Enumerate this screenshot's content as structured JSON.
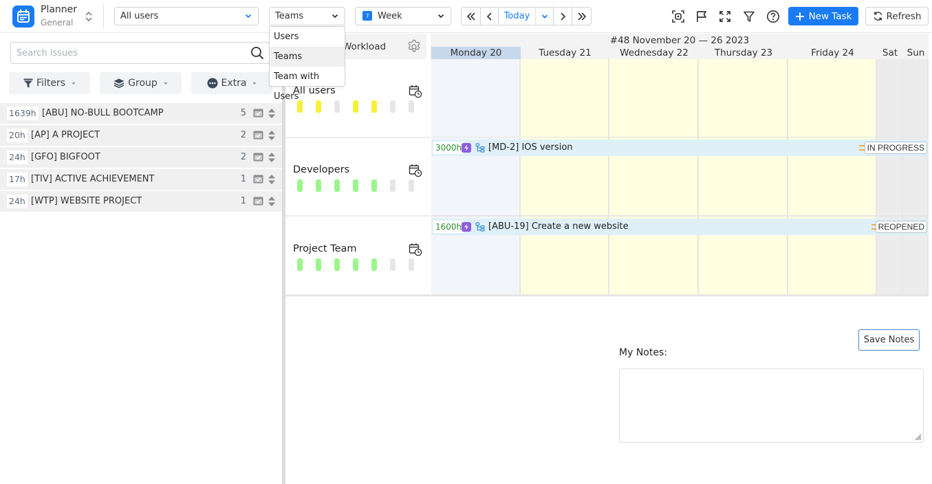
{
  "app": {
    "title": "Planner",
    "subtitle": "General"
  },
  "toolbar": {
    "user_select": "All users",
    "view_select": "Teams",
    "period_select": "Week",
    "period_icon_text": "7",
    "nav": {
      "today_label": "Today"
    },
    "new_task_label": "New Task",
    "refresh_label": "Refresh"
  },
  "view_dropdown": {
    "options": [
      "Users",
      "Teams",
      "Team with Users"
    ],
    "highlighted": "Teams"
  },
  "sidebar": {
    "search_placeholder": "Search issues",
    "buttons": {
      "filters": "Filters",
      "group": "Group",
      "extra": "Extra"
    },
    "projects": [
      {
        "hours": "1639h",
        "name": "[ABU] NO-BULL BOOTCAMP",
        "count": "5"
      },
      {
        "hours": "20h",
        "name": "[AP] A PROJECT",
        "count": "2"
      },
      {
        "hours": "24h",
        "name": "[GFO] BIGFOOT",
        "count": "2"
      },
      {
        "hours": "17h",
        "name": "[TIV] ACTIVE ACHIEVEMENT",
        "count": "1"
      },
      {
        "hours": "24h",
        "name": "[WTP] WEBSITE PROJECT",
        "count": "1"
      }
    ]
  },
  "workload": {
    "header_label": "Workload",
    "week_title": "#48 November 20 — 26 2023",
    "days": [
      "Monday 20",
      "Tuesday 21",
      "Wednesday 22",
      "Thursday 23",
      "Friday 24",
      "Sat",
      "Sun"
    ],
    "today_index": 0,
    "colors": {
      "load_yellow": "#f7f03a",
      "load_green": "#9bf58a",
      "load_empty": "#e6e6e6",
      "accent": "#1a7cf2"
    },
    "teams": [
      {
        "name": "All users",
        "day_load": [
          "yellow",
          "yellow",
          "empty",
          "yellow",
          "yellow",
          "empty",
          "empty"
        ],
        "task": null
      },
      {
        "name": "Developers",
        "day_load": [
          "green",
          "green",
          "green",
          "green",
          "green",
          "empty",
          "empty"
        ],
        "task": {
          "hours": "3000h",
          "title": "[MD-2] IOS version",
          "status": "IN PROGRESS",
          "priority": "medium"
        }
      },
      {
        "name": "Project Team",
        "day_load": [
          "green",
          "green",
          "green",
          "green",
          "green",
          "empty",
          "empty"
        ],
        "task": {
          "hours": "1600h",
          "title": "[ABU-19] Create a new website",
          "status": "REOPENED",
          "priority": "medium"
        }
      }
    ]
  },
  "notes": {
    "label": "My Notes:",
    "save_label": "Save Notes",
    "value": ""
  }
}
